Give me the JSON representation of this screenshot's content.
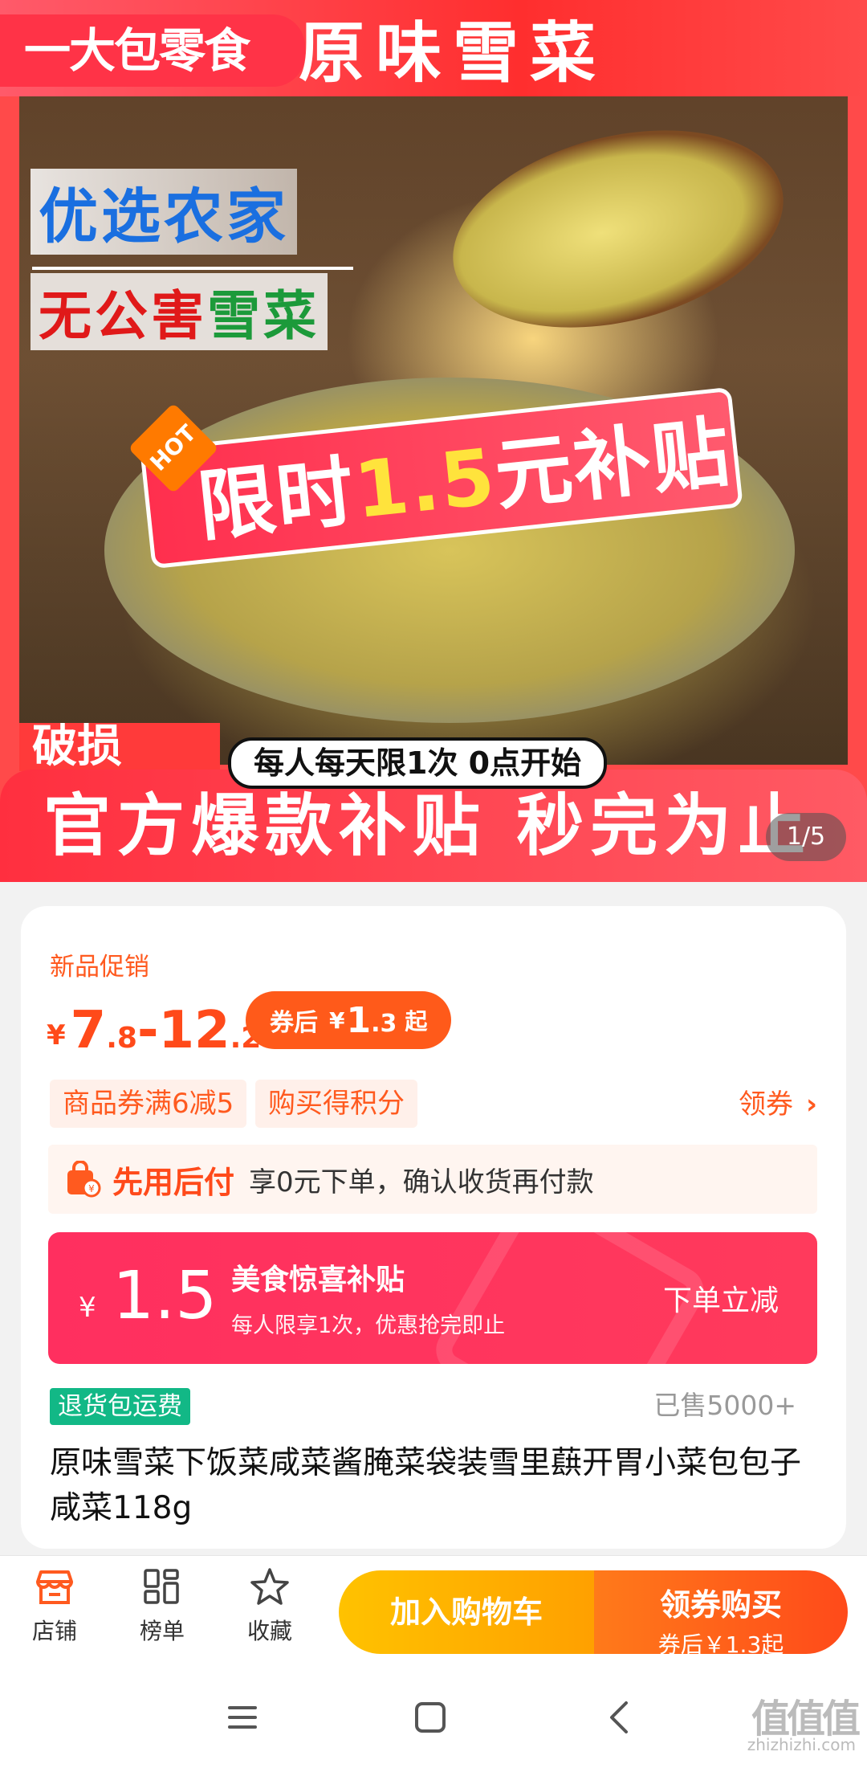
{
  "hero": {
    "brand": "一大包零食",
    "title": "原味雪菜",
    "tagline1": "优选农家",
    "tagline2_a": "无公害",
    "tagline2_b": "雪菜",
    "sticker_hot": "HOT",
    "sticker_pre": "限时",
    "sticker_amount": "1.5",
    "sticker_post": "元补贴",
    "limit_note": "每人每天限1次  0点开始",
    "side_text": "破损",
    "footer_text": "官方爆款补贴 秒完为止",
    "counter": "1/5"
  },
  "product": {
    "promo_label": "新品促销",
    "price_symbol": "¥",
    "price_low_int": "7",
    "price_low_dec": ".8",
    "price_dash": "-",
    "price_high_int": "12",
    "price_high_dec": ".2",
    "coupon_label": "券后",
    "coupon_symbol": "¥",
    "coupon_int": "1",
    "coupon_dec": ".3",
    "coupon_suffix": "起",
    "tags": [
      "商品券满6减5",
      "购买得积分"
    ],
    "get_coupon": "领券",
    "paylater_title": "先用后付",
    "paylater_desc": "享0元下单，确认收货再付款",
    "subsidy_symbol": "¥",
    "subsidy_amount": "1.5",
    "subsidy_title": "美食惊喜补贴",
    "subsidy_desc": "每人限享1次，优惠抢完即止",
    "subsidy_cta": "下单立减",
    "free_return": "退货包运费",
    "sold": "已售5000+",
    "title": "原味雪菜下饭菜咸菜酱腌菜袋装雪里蕻开胃小菜包包子咸菜118g"
  },
  "action_bar": {
    "shop": "店铺",
    "ranking": "榜单",
    "favorite": "收藏",
    "add_cart": "加入购物车",
    "buy_main": "领券购买",
    "buy_sub": "券后￥1.3起"
  },
  "watermark": {
    "text": "值值值",
    "site": "zhizhizhi.com"
  },
  "colors": {
    "accent_orange": "#ff5a1f",
    "subsidy_red": "#ff2f5f",
    "green_tag": "#12b886",
    "cart_yellow": "#ffb000"
  }
}
